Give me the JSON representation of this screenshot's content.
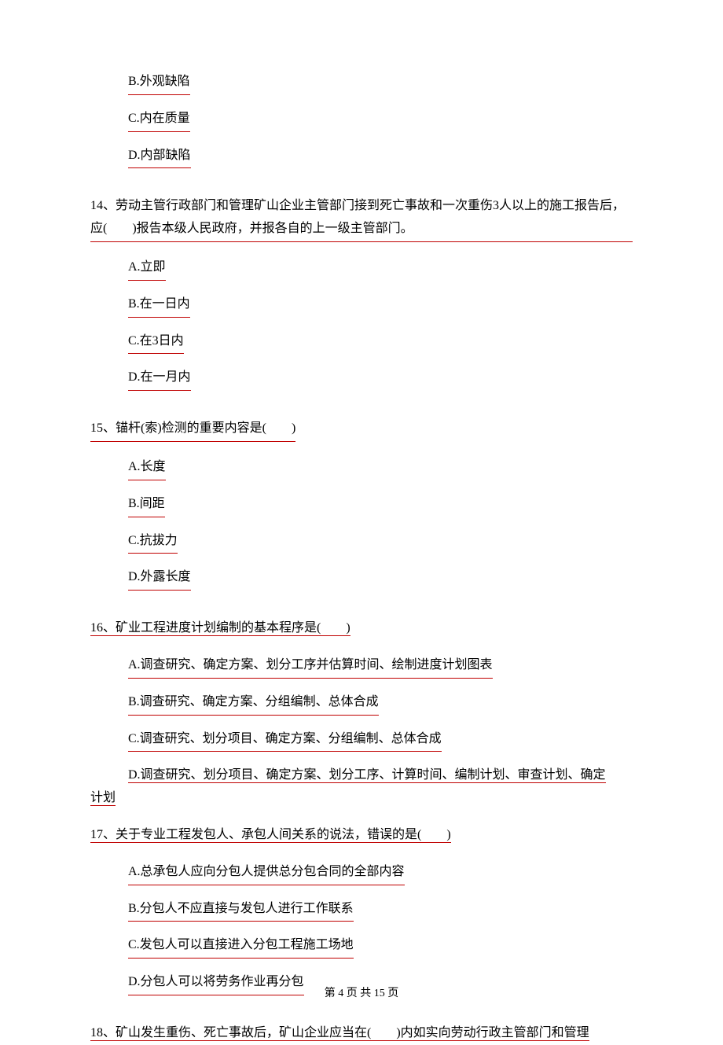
{
  "q13": {
    "optB": "B.外观缺陷",
    "optC": "C.内在质量",
    "optD": "D.内部缺陷"
  },
  "q14": {
    "text": "14、劳动主管行政部门和管理矿山企业主管部门接到死亡事故和一次重伤3人以上的施工报告后，应(　　)报告本级人民政府，并报各自的上一级主管部门。",
    "optA": "A.立即",
    "optB": "B.在一日内",
    "optC": "C.在3日内",
    "optD": "D.在一月内"
  },
  "q15": {
    "text": "15、锚杆(索)检测的重要内容是(　　)",
    "optA": "A.长度",
    "optB": "B.间距",
    "optC": "C.抗拔力",
    "optD": "D.外露长度"
  },
  "q16": {
    "text": "16、矿业工程进度计划编制的基本程序是(　　)",
    "optA": "A.调查研究、确定方案、划分工序并估算时间、绘制进度计划图表",
    "optB": "B.调查研究、确定方案、分组编制、总体合成",
    "optC": "C.调查研究、划分项目、确定方案、分组编制、总体合成",
    "optD_line1": "D.调查研究、划分项目、确定方案、划分工序、计算时间、编制计划、审查计划、确定",
    "optD_line2": "计划"
  },
  "q17": {
    "text": "17、关于专业工程发包人、承包人间关系的说法，错误的是(　　)",
    "optA": "A.总承包人应向分包人提供总分包合同的全部内容",
    "optB": "B.分包人不应直接与发包人进行工作联系",
    "optC": "C.发包人可以直接进入分包工程施工场地",
    "optD": "D.分包人可以将劳务作业再分包"
  },
  "q18": {
    "text": "18、矿山发生重伤、死亡事故后，矿山企业应当在(　　)内如实向劳动行政主管部门和管理"
  },
  "footer": {
    "text": "第 4 页 共 15 页"
  }
}
